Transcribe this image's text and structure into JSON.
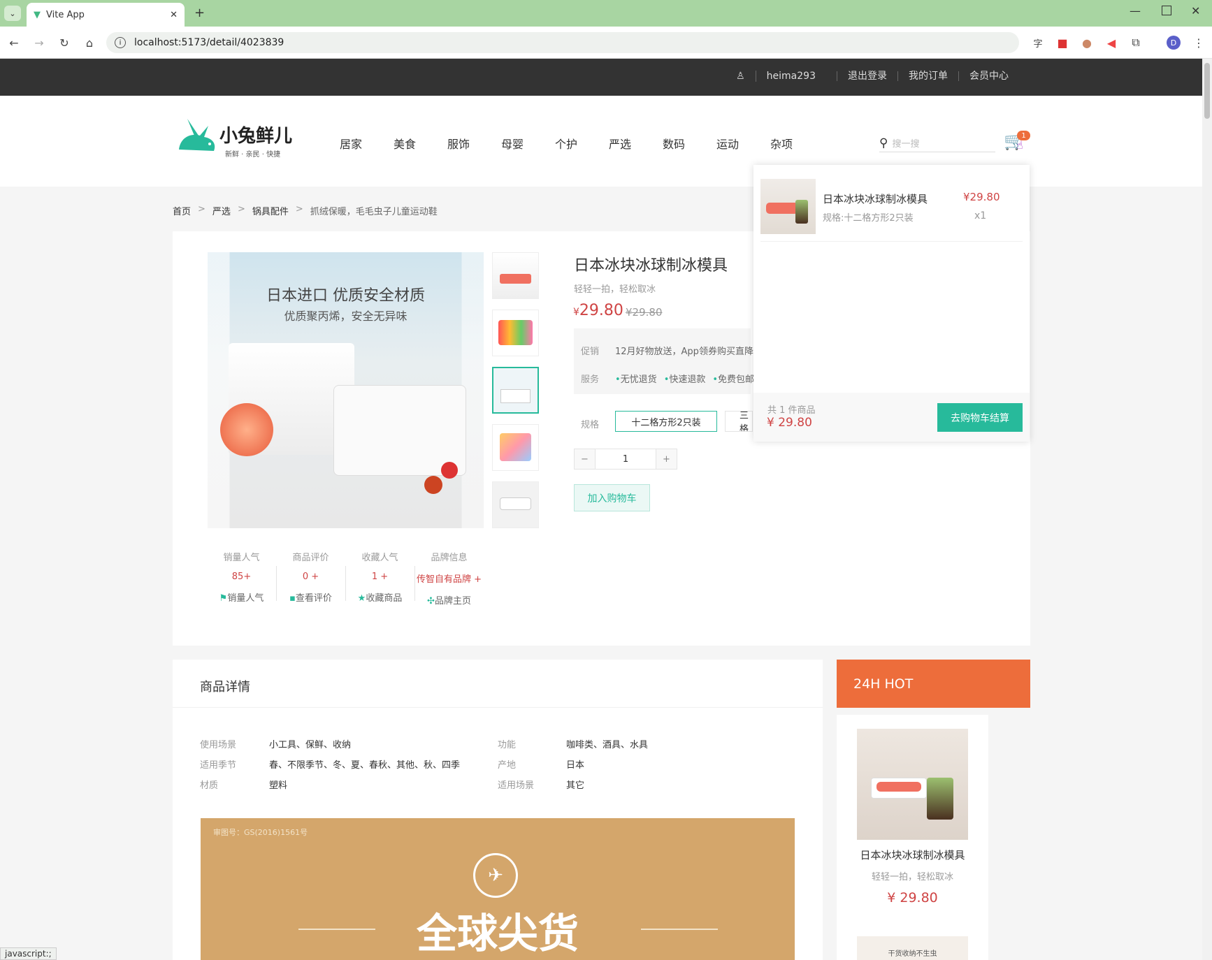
{
  "browser": {
    "tab_title": "Vite App",
    "url": "localhost:5173/detail/4023839",
    "status_text": "javascript:;"
  },
  "topbar": {
    "user": "heima293",
    "logout": "退出登录",
    "orders": "我的订单",
    "member": "会员中心"
  },
  "logo": {
    "text": "小兔鲜儿",
    "slogan": "新鲜 · 亲民 · 快捷"
  },
  "nav": [
    "居家",
    "美食",
    "服饰",
    "母婴",
    "个护",
    "严选",
    "数码",
    "运动",
    "杂项"
  ],
  "search": {
    "placeholder": "搜一搜"
  },
  "cart": {
    "badge": "1",
    "item_name": "日本冰块冰球制冰模具",
    "item_spec": "规格:十二格方形2只装",
    "item_price": "¥29.80",
    "item_qty": "x1",
    "summary_count": "共 1 件商品",
    "summary_total": "¥ 29.80",
    "checkout": "去购物车结算"
  },
  "breadcrumb": [
    "首页",
    "严选",
    "锅具配件",
    "抓绒保暖，毛毛虫子儿童运动鞋"
  ],
  "product": {
    "name": "日本冰块冰球制冰模具",
    "desc": "轻轻一拍，轻松取冰",
    "price": "29.80",
    "price_symbol": "¥",
    "old_price": "¥29.80",
    "promo_label": "促销",
    "promo_text": "12月好物放送，App领券购买直降",
    "service_label": "服务",
    "services": [
      "无忧退货",
      "快速退款",
      "免费包邮"
    ],
    "spec_label": "规格",
    "spec_selected": "十二格方形2只装",
    "spec_other": "三格",
    "qty": "1",
    "add_cart": "加入购物车",
    "img_headline": "日本进口 优质安全材质",
    "img_sub": "优质聚丙烯，安全无异味"
  },
  "stats": [
    {
      "k": "销量人气",
      "v": "85+",
      "a": "销量人气"
    },
    {
      "k": "商品评价",
      "v": "0 +",
      "a": "查看评价"
    },
    {
      "k": "收藏人气",
      "v": "1 +",
      "a": "收藏商品"
    },
    {
      "k": "品牌信息",
      "v": "传智自有品牌 +",
      "a": "品牌主页"
    }
  ],
  "details": {
    "title": "商品详情",
    "attrs": [
      {
        "k": "使用场景",
        "v": "小工具、保鲜、收纳"
      },
      {
        "k": "功能",
        "v": "咖啡类、酒具、水具"
      },
      {
        "k": "适用季节",
        "v": "春、不限季节、冬、夏、春秋、其他、秋、四季"
      },
      {
        "k": "产地",
        "v": "日本"
      },
      {
        "k": "材质",
        "v": "塑料"
      },
      {
        "k": "适用场景",
        "v": "其它"
      }
    ],
    "banner_note": "审图号：GS(2016)1561号",
    "banner_text": "全球尖货"
  },
  "hot": {
    "title": "24H HOT",
    "item_name": "日本冰块冰球制冰模具",
    "item_desc": "轻轻一拍，轻松取冰",
    "item_price": "¥ 29.80",
    "next_caption": "干货收纳不生虫"
  },
  "colors": {
    "brand": "#27ba9b",
    "price": "#cf4444",
    "hot": "#ed6d3b"
  }
}
